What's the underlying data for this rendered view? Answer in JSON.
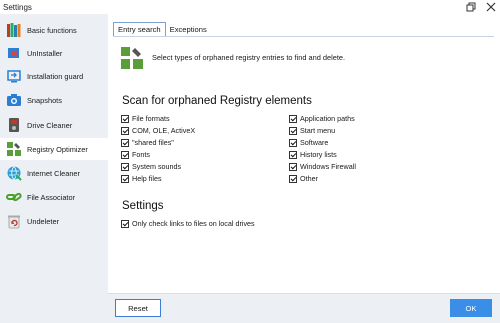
{
  "window": {
    "title": "Settings"
  },
  "sidebar": {
    "items": [
      {
        "label": "Basic functions",
        "icon": "books-icon"
      },
      {
        "label": "UnInstaller",
        "icon": "uninstaller-icon"
      },
      {
        "label": "Installation guard",
        "icon": "installation-guard-icon"
      },
      {
        "label": "Snapshots",
        "icon": "camera-icon"
      },
      {
        "label": "Drive Cleaner",
        "icon": "drive-cleaner-icon"
      },
      {
        "label": "Registry Optimizer",
        "icon": "registry-optimizer-icon",
        "active": true
      },
      {
        "label": "Internet Cleaner",
        "icon": "internet-cleaner-icon"
      },
      {
        "label": "File Associator",
        "icon": "file-associator-icon"
      },
      {
        "label": "Undeleter",
        "icon": "undeleter-icon"
      }
    ]
  },
  "tabs": [
    {
      "label": "Entry search",
      "active": true
    },
    {
      "label": "Exceptions",
      "active": false
    }
  ],
  "intro": {
    "text": "Select types of orphaned registry entries to find and delete."
  },
  "scan": {
    "title": "Scan for orphaned Registry elements",
    "left": [
      {
        "label": "File formats",
        "checked": true
      },
      {
        "label": "COM, OLE, ActiveX",
        "checked": true
      },
      {
        "label": "\"shared files\"",
        "checked": true
      },
      {
        "label": "Fonts",
        "checked": true
      },
      {
        "label": "System sounds",
        "checked": true
      },
      {
        "label": "Help files",
        "checked": true
      }
    ],
    "right": [
      {
        "label": "Application paths",
        "checked": true
      },
      {
        "label": "Start menu",
        "checked": true
      },
      {
        "label": "Software",
        "checked": true
      },
      {
        "label": "History lists",
        "checked": true
      },
      {
        "label": "Windows Firewall",
        "checked": true
      },
      {
        "label": "Other",
        "checked": true
      }
    ]
  },
  "settings": {
    "title": "Settings",
    "options": [
      {
        "label": "Only check links to files on local drives",
        "checked": true
      }
    ]
  },
  "footer": {
    "reset_label": "Reset",
    "ok_label": "OK"
  },
  "colors": {
    "accent": "#3b8ee6",
    "sidebar_bg": "#ecf0f5",
    "active_item_bg": "#ffffff"
  }
}
